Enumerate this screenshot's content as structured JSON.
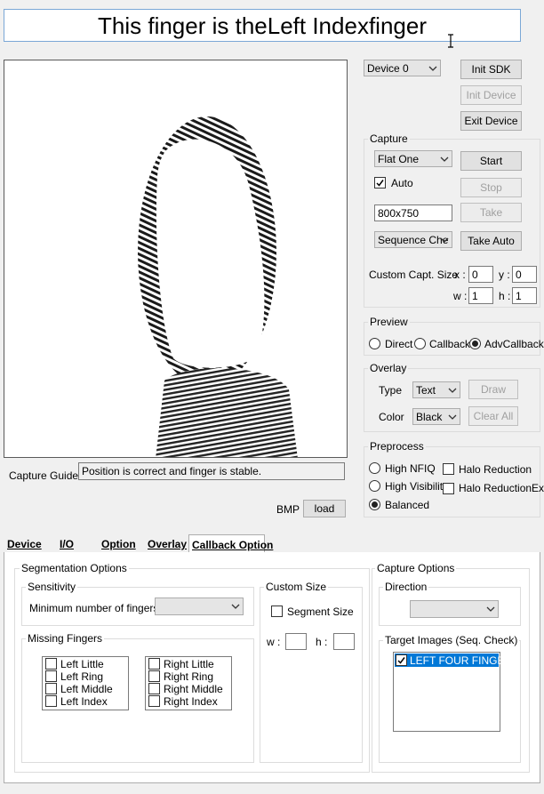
{
  "header": {
    "title": "This finger is theLeft Indexfinger"
  },
  "device": {
    "select_value": "Device 0",
    "init_sdk": "Init SDK",
    "init_device": "Init Device",
    "exit_device": "Exit Device"
  },
  "capture": {
    "group_label": "Capture",
    "mode_value": "Flat One",
    "auto_label": "Auto",
    "auto_checked": true,
    "resolution_value": "800x750",
    "sequence_value": "Sequence Che",
    "start": "Start",
    "stop": "Stop",
    "take": "Take",
    "take_auto": "Take Auto",
    "custom_size_label": "Custom Capt. Size",
    "x_label": "x :",
    "x_value": "0",
    "y_label": "y :",
    "y_value": "0",
    "w_label": "w :",
    "w_value": "1",
    "h_label": "h :",
    "h_value": "1"
  },
  "preview": {
    "group_label": "Preview",
    "options": [
      "Direct",
      "Callback",
      "AdvCallback"
    ],
    "selected": "AdvCallback"
  },
  "overlay": {
    "group_label": "Overlay",
    "type_label": "Type",
    "type_value": "Text",
    "color_label": "Color",
    "color_value": "Black",
    "draw": "Draw",
    "clear_all": "Clear All"
  },
  "preprocess": {
    "group_label": "Preprocess",
    "high_nfiq": "High NFIQ",
    "high_visibility": "High Visibility",
    "balanced": "Balanced",
    "halo_reduction": "Halo Reduction",
    "halo_reduction_ex": "Halo ReductionEx",
    "selected": "Balanced"
  },
  "guide": {
    "label": "Capture Guide :",
    "message": "Position is correct and finger is stable."
  },
  "bmp": {
    "label": "BMP",
    "load": "load"
  },
  "tabs": [
    "Device",
    "I/O",
    "Option",
    "Overlay",
    "Callback Option"
  ],
  "segmentation": {
    "group_label": "Segmentation Options",
    "sensitivity_label": "Sensitivity",
    "min_fingers_label": "Minimum number of fingers :",
    "missing_label": "Missing Fingers",
    "left_fingers": [
      "Left Little",
      "Left Ring",
      "Left Middle",
      "Left Index"
    ],
    "right_fingers": [
      "Right Little",
      "Right Ring",
      "Right Middle",
      "Right Index"
    ],
    "custom_size_label": "Custom Size",
    "segment_size_label": "Segment Size",
    "w_label": "w :",
    "h_label": "h :"
  },
  "capture_options": {
    "group_label": "Capture Options",
    "direction_label": "Direction",
    "target_label": "Target Images (Seq. Check)",
    "target_item": "LEFT FOUR FINGER"
  },
  "colors": {
    "accent": "#0078d7",
    "selection": "#0078d7"
  }
}
